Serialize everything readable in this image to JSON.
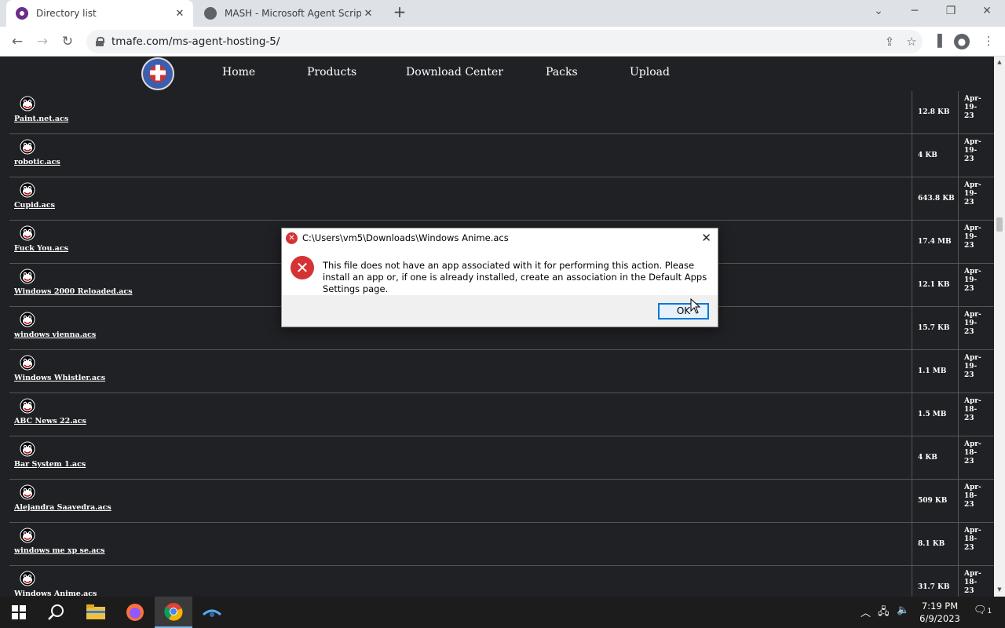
{
  "browser": {
    "tabs": [
      {
        "title": "Directory list",
        "active": true
      },
      {
        "title": "MASH - Microsoft Agent Scripting",
        "active": false
      }
    ],
    "url": "tmafe.com/ms-agent-hosting-5/"
  },
  "site_nav": {
    "items": [
      "Home",
      "Products",
      "Download Center",
      "Packs",
      "Upload"
    ]
  },
  "files": [
    {
      "name": "Paint.net.acs",
      "size": "12.8 KB",
      "date": [
        "Apr-",
        "19-",
        "23"
      ]
    },
    {
      "name": "robotic.acs",
      "size": "4 KB",
      "date": [
        "Apr-",
        "19-",
        "23"
      ]
    },
    {
      "name": "Cupid.acs",
      "size": "643.8 KB",
      "date": [
        "Apr-",
        "19-",
        "23"
      ]
    },
    {
      "name": "Fuck You.acs",
      "size": "17.4 MB",
      "date": [
        "Apr-",
        "19-",
        "23"
      ]
    },
    {
      "name": "Windows 2000 Reloaded.acs",
      "size": "12.1 KB",
      "date": [
        "Apr-",
        "19-",
        "23"
      ]
    },
    {
      "name": "windows vienna.acs",
      "size": "15.7 KB",
      "date": [
        "Apr-",
        "19-",
        "23"
      ]
    },
    {
      "name": "Windows Whistler.acs",
      "size": "1.1 MB",
      "date": [
        "Apr-",
        "19-",
        "23"
      ]
    },
    {
      "name": "ABC News 22.acs",
      "size": "1.5 MB",
      "date": [
        "Apr-",
        "18-",
        "23"
      ]
    },
    {
      "name": "Bar System 1.acs",
      "size": "4 KB",
      "date": [
        "Apr-",
        "18-",
        "23"
      ]
    },
    {
      "name": "Alejandra Saavedra.acs",
      "size": "509 KB",
      "date": [
        "Apr-",
        "18-",
        "23"
      ]
    },
    {
      "name": "windows me xp se.acs",
      "size": "8.1 KB",
      "date": [
        "Apr-",
        "18-",
        "23"
      ]
    },
    {
      "name": "Windows Anime.acs",
      "size": "31.7 KB",
      "date": [
        "Apr-",
        "18-",
        "23"
      ]
    }
  ],
  "dialog": {
    "title": "C:\\Users\\vm5\\Downloads\\Windows Anime.acs",
    "message": "This file does not have an app associated with it for performing this action. Please install an app or, if one is already installed, create an association in the Default Apps Settings page.",
    "ok_label": "OK"
  },
  "taskbar": {
    "time": "7:19 PM",
    "date": "6/9/2023",
    "notification_count": "1"
  },
  "colors": {
    "page_bg": "#202124",
    "error_red": "#d53333",
    "focus_blue": "#0078d7"
  }
}
